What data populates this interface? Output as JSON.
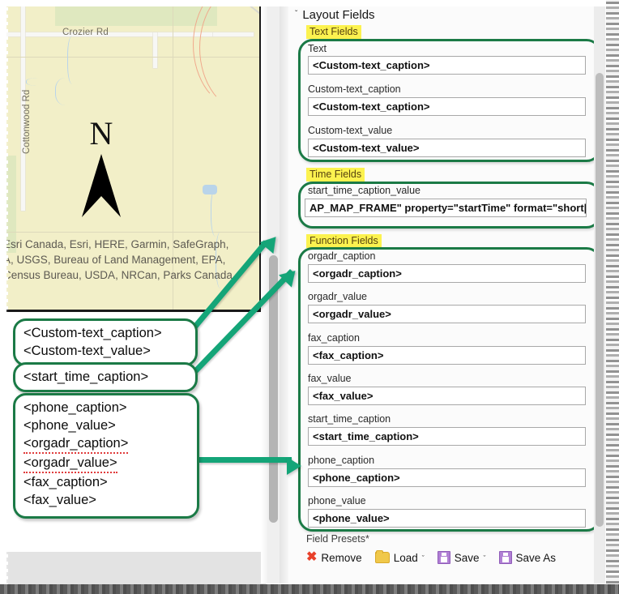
{
  "map": {
    "labels": {
      "road_horizontal": "Crozier Rd",
      "road_vertical": "Cottonwood Rd",
      "north": "N"
    },
    "attribution_lines": [
      "Esri Canada, Esri, HERE, Garmin, SafeGraph,",
      "A, USGS, Bureau of Land Management, EPA,",
      "Census Bureau, USDA, NRCan, Parks Canada"
    ]
  },
  "callouts": {
    "custom_text": [
      "<Custom-text_caption>",
      "<Custom-text_value>"
    ],
    "start_time": [
      "<start_time_caption>"
    ],
    "function": [
      "<phone_caption>",
      "<phone_value>",
      "<orgadr_caption>",
      "<orgadr_value>",
      "<fax_caption>",
      "<fax_value>"
    ]
  },
  "panel": {
    "title": "Layout Fields",
    "chevron": "ˇ",
    "groups": {
      "text_fields": "Text Fields",
      "time_fields": "Time Fields",
      "function_fields": "Function Fields"
    },
    "text_fields": [
      {
        "label": "Text",
        "value": "<Custom-text_caption>"
      },
      {
        "label": "Custom-text_caption",
        "value": "<Custom-text_caption>"
      },
      {
        "label": "Custom-text_value",
        "value": "<Custom-text_value>"
      }
    ],
    "time_fields": [
      {
        "label": "start_time_caption_value",
        "value": "AP_MAP_FRAME\" property=\"startTime\" format=\"short|short\""
      }
    ],
    "function_fields": [
      {
        "label": "orgadr_caption",
        "value": "<orgadr_caption>"
      },
      {
        "label": "orgadr_value",
        "value": "<orgadr_value>"
      },
      {
        "label": "fax_caption",
        "value": "<fax_caption>"
      },
      {
        "label": "fax_value",
        "value": "<fax_value>"
      },
      {
        "label": "start_time_caption",
        "value": "<start_time_caption>"
      },
      {
        "label": "phone_caption",
        "value": "<phone_caption>"
      },
      {
        "label": "phone_value",
        "value": "<phone_value>"
      }
    ],
    "presets": {
      "label": "Field Presets*",
      "remove": "Remove",
      "load": "Load",
      "save": "Save",
      "save_as": "Save As",
      "caret": "ˇ"
    }
  },
  "colors": {
    "highlight_green": "#1b7a46",
    "arrow_green": "#14a578",
    "tag_yellow": "#fcf24f",
    "map_fill": "#f2efc8"
  }
}
